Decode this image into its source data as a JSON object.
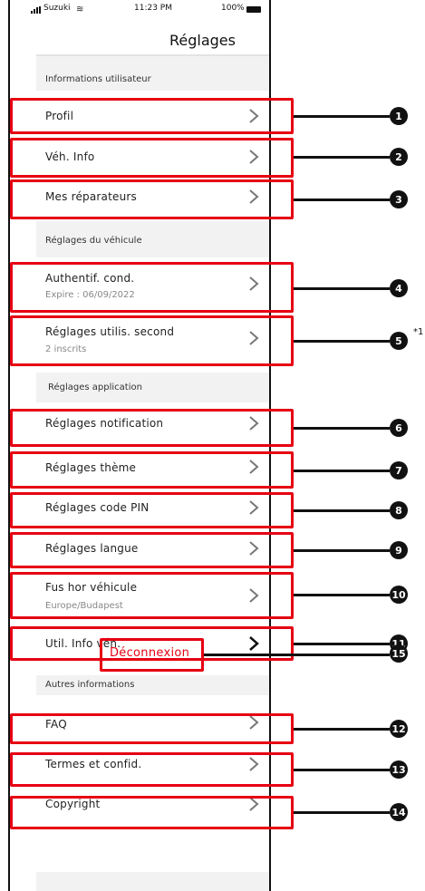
{
  "status_bar": {
    "carrier": "Suzuki",
    "time": "11:23 PM",
    "battery": "100%"
  },
  "header": {
    "title": "Réglages"
  },
  "sections": {
    "user": "Informations utilisateur",
    "vehicle": "Réglages du véhicule",
    "app": "Réglages application",
    "other": "Autres informations"
  },
  "items": [
    {
      "label": "Profil",
      "badge": "1"
    },
    {
      "label": "Véh. Info",
      "badge": "2"
    },
    {
      "label": "Mes réparateurs",
      "badge": "3"
    },
    {
      "label": "Authentif. cond.",
      "sub": "Expire : 06/09/2022",
      "badge": "4"
    },
    {
      "label": "Réglages utilis. second",
      "sub": "2 inscrits",
      "badge": "5"
    },
    {
      "label": "Réglages notification",
      "badge": "6"
    },
    {
      "label": "Réglages thème",
      "badge": "7"
    },
    {
      "label": "Réglages code PIN",
      "badge": "8"
    },
    {
      "label": "Réglages langue",
      "badge": "9"
    },
    {
      "label": "Fus hor véhicule",
      "sub": "Europe/Budapest",
      "badge": "10"
    },
    {
      "label": "Util. Info véh.",
      "badge": "11"
    },
    {
      "label": "FAQ",
      "badge": "12"
    },
    {
      "label": "Termes et confid.",
      "badge": "13"
    },
    {
      "label": "Copyright",
      "badge": "14"
    }
  ],
  "logout": {
    "label": "Déconnexion",
    "badge": "15"
  },
  "footnote": "*1",
  "colors": {
    "highlight": "#e60012",
    "badge": "#111111"
  }
}
